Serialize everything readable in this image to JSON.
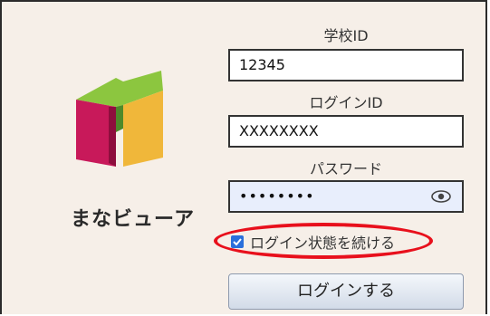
{
  "brand": {
    "logo_text": "まなビューア",
    "colors": {
      "green": "#8cc63f",
      "magenta": "#c8195a",
      "dark_magenta": "#8e0e3d",
      "yellow": "#f0b73a",
      "dark_green": "#4e8a2a"
    }
  },
  "form": {
    "school_id": {
      "label": "学校ID",
      "value": "12345"
    },
    "login_id": {
      "label": "ログインID",
      "value": "XXXXXXXX"
    },
    "password": {
      "label": "パスワード",
      "value": "••••••••",
      "toggle_icon": "eye-icon"
    },
    "keep_logged_in": {
      "label": "ログイン状態を続ける",
      "checked": true,
      "highlight_color": "#e8101c"
    },
    "submit_label": "ログインする"
  }
}
